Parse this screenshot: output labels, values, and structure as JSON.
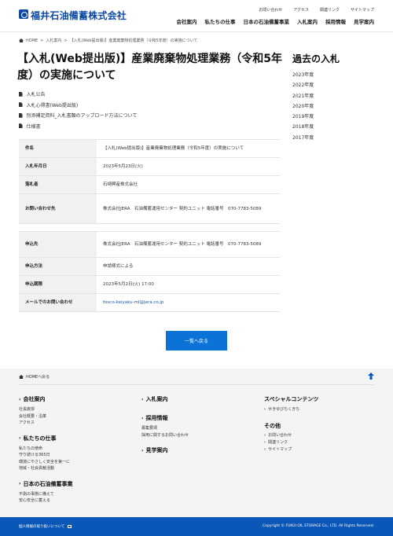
{
  "header": {
    "logo": "福井石油備蓄株式会社",
    "util_nav": [
      "お問い合わせ",
      "アクセス",
      "関連リンク",
      "サイトマップ"
    ],
    "main_nav": [
      "会社案内",
      "私たちの仕事",
      "日本の石油備蓄事業",
      "入札案内",
      "採用情報",
      "見学案内"
    ]
  },
  "breadcrumb": [
    "HOME",
    "入札案内",
    "【入札(Web提出版)】産業廃棄物処理業務（令和5年度）の実施について"
  ],
  "page": {
    "title": "【入札(Web提出版)】産業廃棄物処理業務（令和5年度）の実施について"
  },
  "documents": [
    "入札公告",
    "入札心得書(Web提出版)",
    "別添補足資料_入札書類のアップロード方法について",
    "仕様書"
  ],
  "table1": [
    {
      "label": "件名",
      "value": "【入札(Web提出版)】産業廃棄物処理業務（令和5年度）の実施について"
    },
    {
      "label": "入札年月日",
      "value": "2023年5月23日(火)"
    },
    {
      "label": "落札者",
      "value": "石崎興産株式会社"
    },
    {
      "label": "お問い合わせ先",
      "value": "株式会社JERA　石油備蓄運用センター 契約ユニット 電話番号　070-7783-5089"
    }
  ],
  "table2": [
    {
      "label": "申込先",
      "value": "株式会社JERA　石油備蓄運用センター 契約ユニット 電話番号　070-7783-5089"
    },
    {
      "label": "申込方法",
      "value": "申請様式による"
    },
    {
      "label": "申込期限",
      "value": "2023年5月2日(火) 17:00"
    },
    {
      "label": "メールでのお問い合わせ",
      "value": "fosco-keiyaku-ml@jera.co.jp"
    }
  ],
  "back_button": "一覧へ戻る",
  "sidebar": {
    "title": "過去の入札",
    "years": [
      "2023年度",
      "2022年度",
      "2021年度",
      "2020年度",
      "2019年度",
      "2018年度",
      "2017年度"
    ]
  },
  "footer": {
    "home_link": "HOMEへ戻る",
    "col1": [
      {
        "head": "会社案内",
        "items": [
          "社長挨拶",
          "会社概要・沿革",
          "アクセス"
        ]
      },
      {
        "head": "私たちの仕事",
        "items": [
          "私たちの使命",
          "守り続ける365日",
          "環境にやさしく安全を第一に",
          "地域・社会貢献活動"
        ]
      },
      {
        "head": "日本の石油備蓄事業",
        "items": [
          "不測の事態に備えて",
          "安心安全に蓄える"
        ]
      }
    ],
    "col2": [
      {
        "head": "入札案内",
        "items": []
      },
      {
        "head": "採用情報",
        "items": [
          "募集要項",
          "採用に関するお問い合わせ"
        ]
      },
      {
        "head": "見学案内",
        "items": []
      }
    ],
    "col3": [
      {
        "head": "スペシャルコンテンツ",
        "items": [
          "せきゆびちくきち"
        ]
      },
      {
        "head": "その他",
        "items": [
          "お問い合わせ",
          "関連リンク",
          "サイトマップ"
        ]
      }
    ],
    "privacy": "個人情報の取り扱いについて",
    "copyright": "Copyright © FUKUI OIL STORAGE Co., LTD. All Rights Reserved.",
    "accent_color": "#0b57b7"
  }
}
